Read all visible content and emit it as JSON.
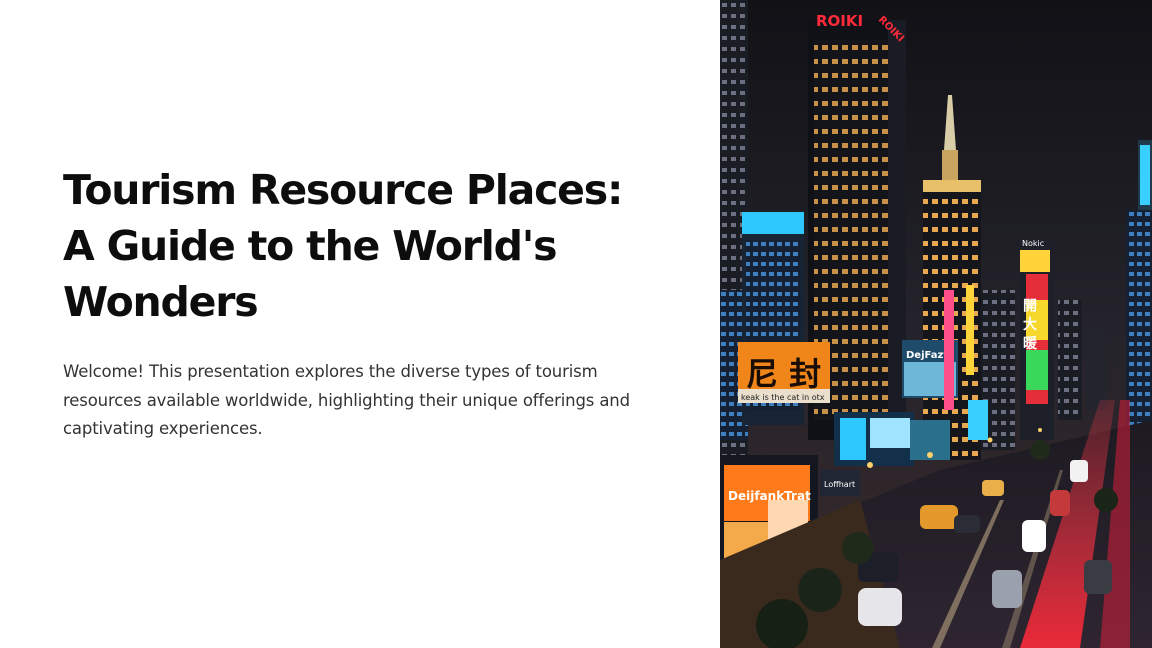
{
  "slide": {
    "title": "Tourism Resource Places: A Guide to the World's Wonders",
    "body": "Welcome! This presentation explores the diverse types of tourism resources available worldwide, highlighting their unique offerings and captivating experiences."
  },
  "image": {
    "signs": {
      "tower_top": "ROIKI",
      "tower_side": "ROIKI",
      "billboard_glyphs": "尼 封",
      "billboard_caption": "keak is the cat in otx",
      "billboard_center": "DejFazt",
      "billboard_left": "DeijfankTrat",
      "billboard_small": "Loffhart",
      "rooftop": "Nokic",
      "vertical_sign": "開 大 暖"
    },
    "colors": {
      "sky": "#1c1c24",
      "neon_cyan": "#2ec8ff",
      "neon_red": "#ff2a3a",
      "neon_orange": "#ff9a1f",
      "street_lights": "#ffcf6a"
    }
  }
}
